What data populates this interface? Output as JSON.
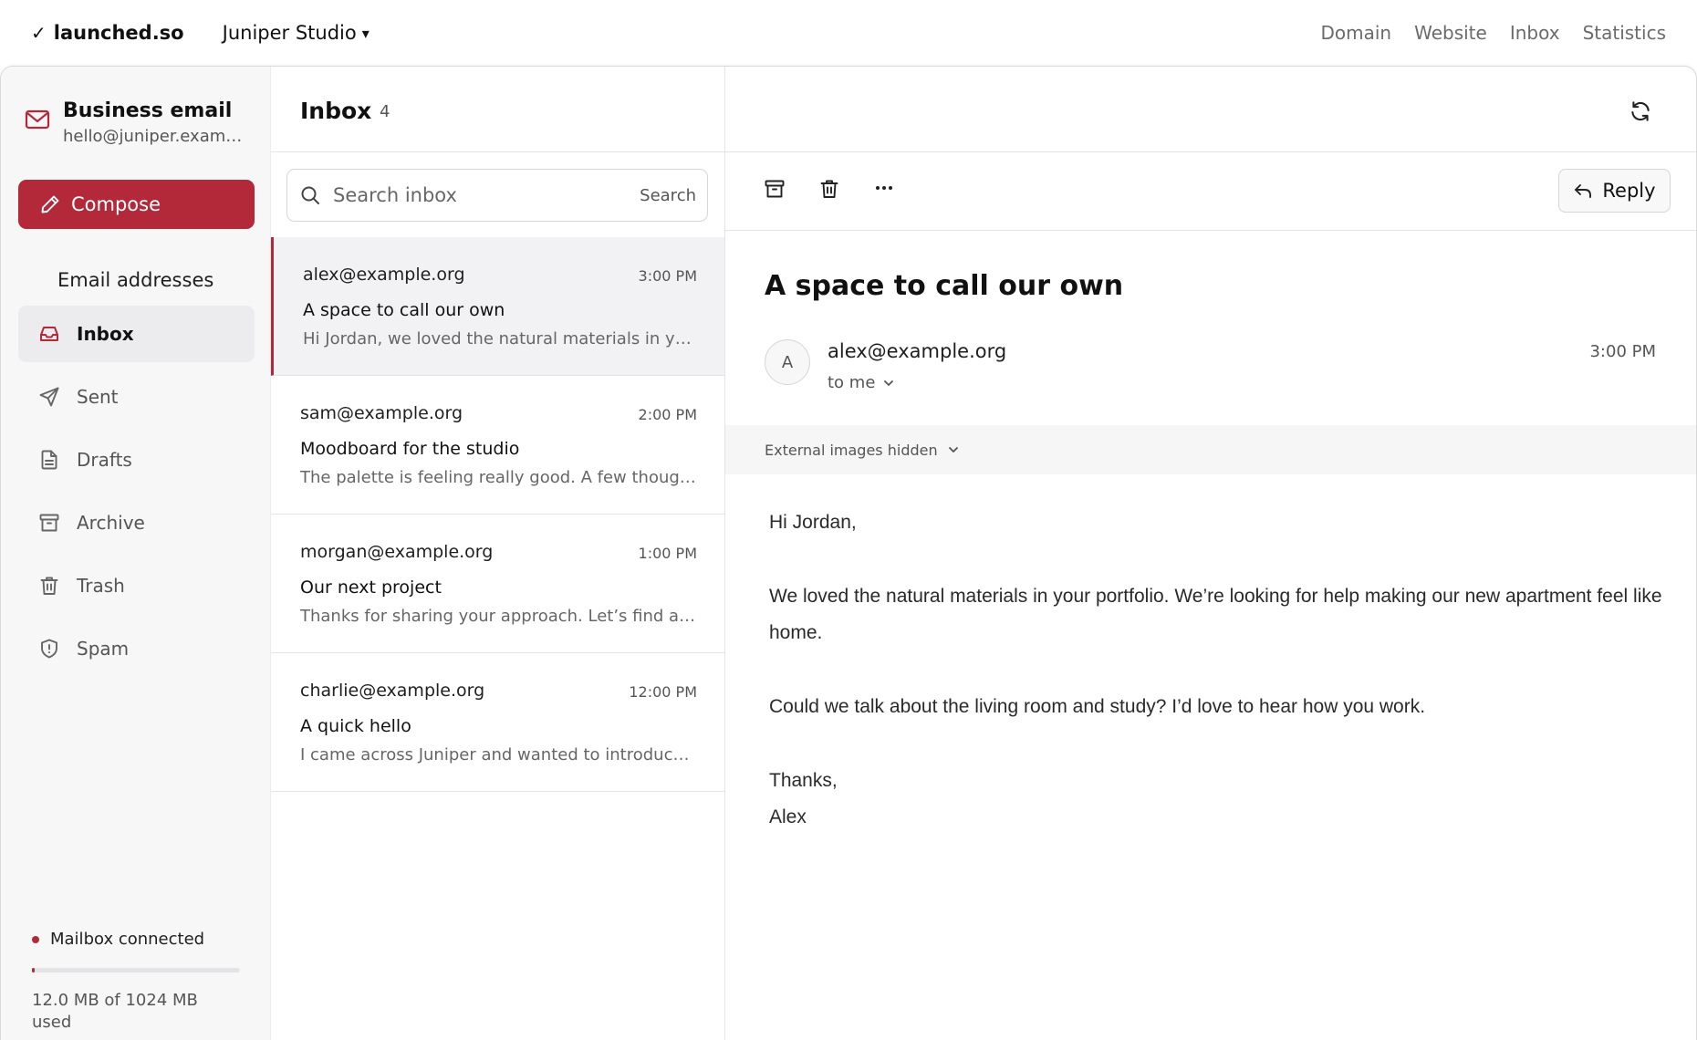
{
  "topbar": {
    "brand": "launched.so",
    "workspace": "Juniper Studio",
    "nav": [
      "Domain",
      "Website",
      "Inbox",
      "Statistics"
    ]
  },
  "colors": {
    "accent": "#b3293a",
    "active_bg": "#ececee",
    "sidebar_bg": "#f7f7f8"
  },
  "sidebar": {
    "account_title": "Business email",
    "account_address": "hello@juniper.example.org",
    "compose_label": "Compose",
    "section_label": "Email addresses",
    "items": [
      {
        "label": "Inbox",
        "icon": "inbox-icon",
        "active": true
      },
      {
        "label": "Sent",
        "icon": "send-icon",
        "active": false
      },
      {
        "label": "Drafts",
        "icon": "file-icon",
        "active": false
      },
      {
        "label": "Archive",
        "icon": "archive-icon",
        "active": false
      },
      {
        "label": "Trash",
        "icon": "trash-icon",
        "active": false
      },
      {
        "label": "Spam",
        "icon": "shield-icon",
        "active": false
      }
    ],
    "status": "Mailbox connected",
    "storage_used_fraction": 0.0117,
    "storage_text": "12.0 MB of 1024 MB used"
  },
  "list": {
    "title": "Inbox",
    "count": "4",
    "search_placeholder": "Search inbox",
    "search_button": "Search",
    "messages": [
      {
        "from": "alex@example.org",
        "time": "3:00 PM",
        "subject": "A space to call our own",
        "preview": "Hi Jordan, we loved the natural materials in your portfolio.",
        "active": true
      },
      {
        "from": "sam@example.org",
        "time": "2:00 PM",
        "subject": "Moodboard for the studio",
        "preview": "The palette is feeling really good. A few thoughts before we continue.",
        "active": false
      },
      {
        "from": "morgan@example.org",
        "time": "1:00 PM",
        "subject": "Our next project",
        "preview": "Thanks for sharing your approach. Let’s find a time to talk.",
        "active": false
      },
      {
        "from": "charlie@example.org",
        "time": "12:00 PM",
        "subject": "A quick hello",
        "preview": "I came across Juniper and wanted to introduce myself.",
        "active": false
      }
    ]
  },
  "reader": {
    "reply_label": "Reply",
    "subject": "A space to call our own",
    "avatar_initial": "A",
    "sender": "alex@example.org",
    "to": "to me",
    "time": "3:00 PM",
    "images_notice": "External images hidden",
    "body": {
      "greeting": "Hi Jordan,",
      "p1": "We loved the natural materials in your portfolio. We’re looking for help making our new apartment feel like home.",
      "p2": "Could we talk about the living room and study? I’d love to hear how you work.",
      "signoff": "Thanks,",
      "signature": "Alex"
    }
  }
}
